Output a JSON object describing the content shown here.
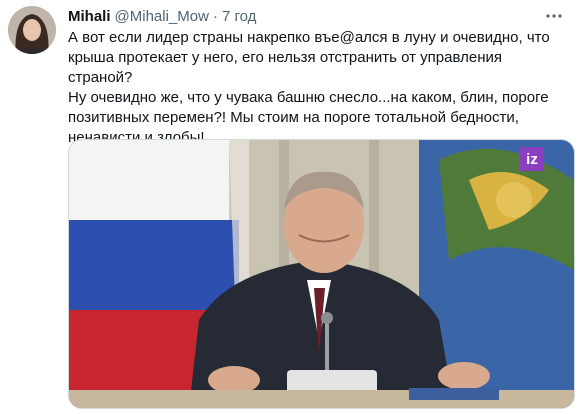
{
  "tweet": {
    "author_name": "Mihali",
    "author_handle": "@Mihali_Mow",
    "separator": "·",
    "timestamp": "7 год",
    "more_icon": "more-icon",
    "text": "А вот если лидер страны накрепко въе@ался в луну и очевидно, что\nкрыша протекает у него, его нельзя отстранить от управления страной?\nНу очевидно же, что у чувака башню снесло...на каком, блин, пороге\nпозитивных перемен?! Мы стоим на пороге тотальной бедности,\nненависти и злобы!",
    "media": {
      "badge_text": "iz",
      "badge_color": "#8a3fbf"
    }
  }
}
